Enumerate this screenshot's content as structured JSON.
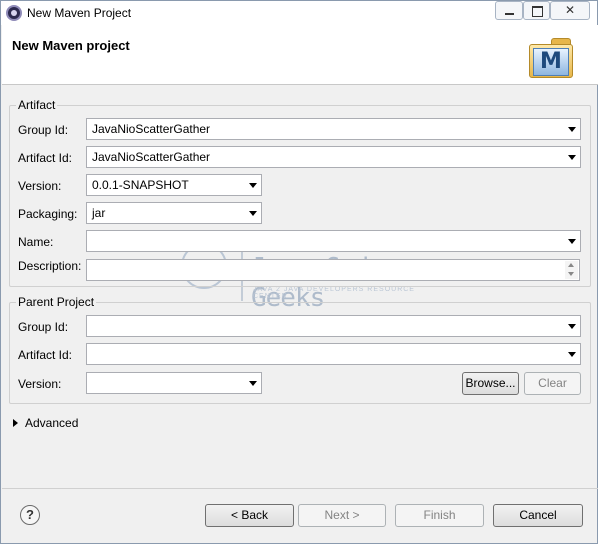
{
  "window": {
    "title": "New Maven Project"
  },
  "banner": {
    "title": "New Maven project"
  },
  "artifact": {
    "group_label": "Artifact",
    "group_id_label": "Group Id:",
    "group_id_value": "JavaNioScatterGather",
    "artifact_id_label": "Artifact Id:",
    "artifact_id_value": "JavaNioScatterGather",
    "version_label": "Version:",
    "version_value": "0.0.1-SNAPSHOT",
    "packaging_label": "Packaging:",
    "packaging_value": "jar",
    "name_label": "Name:",
    "name_value": "",
    "description_label": "Description:",
    "description_value": ""
  },
  "parent": {
    "group_label": "Parent Project",
    "group_id_label": "Group Id:",
    "group_id_value": "",
    "artifact_id_label": "Artifact Id:",
    "artifact_id_value": "",
    "version_label": "Version:",
    "version_value": "",
    "browse_label": "Browse...",
    "clear_label": "Clear"
  },
  "advanced": {
    "label": "Advanced"
  },
  "footer": {
    "help_symbol": "?",
    "back_label": "< Back",
    "next_label": "Next >",
    "finish_label": "Finish",
    "cancel_label": "Cancel"
  },
  "watermark": {
    "badge": "JCG",
    "title": "Java Code Geeks",
    "subtitle": "JAVA 2 JAVA DEVELOPERS RESOURCE CENTER"
  },
  "logo": {
    "letter": "M"
  },
  "icons": [
    "eclipse-app-icon",
    "minimize-icon",
    "maximize-icon",
    "close-icon",
    "maven-logo-icon",
    "chevron-down-icon",
    "expand-arrow-icon",
    "help-icon"
  ]
}
